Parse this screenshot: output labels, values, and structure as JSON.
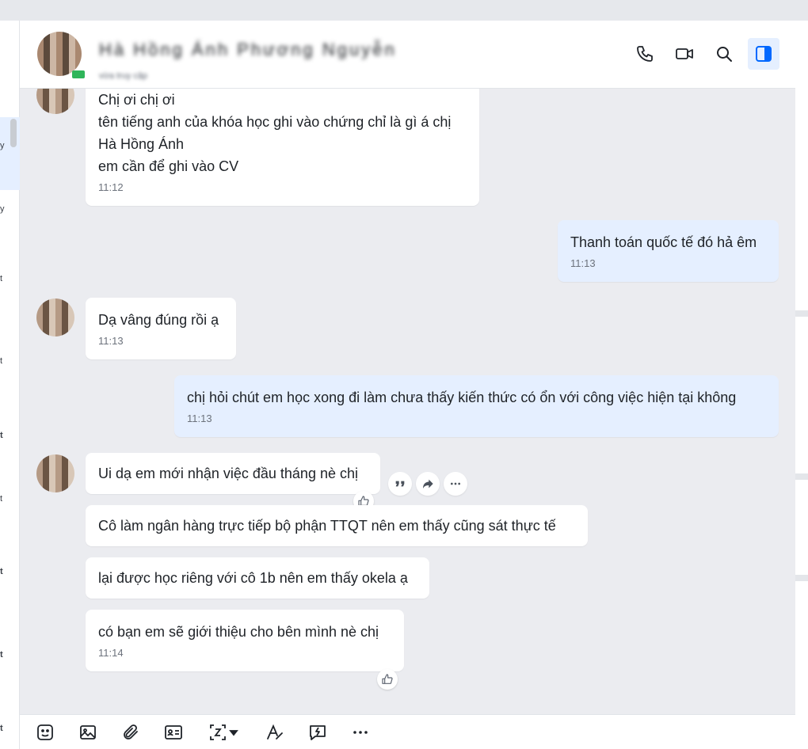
{
  "contact": {
    "name": "Hà Hồng Ánh Phương Nguyễn",
    "status": "vừa truy cập"
  },
  "header_actions": [
    {
      "icon": "phone-icon"
    },
    {
      "icon": "video-call-icon"
    },
    {
      "icon": "search-icon"
    },
    {
      "icon": "sidebar-toggle-icon",
      "active": true
    }
  ],
  "sidebar": {
    "fragments": [
      "y",
      "y",
      "t",
      "t",
      "t",
      "t",
      "t",
      "t",
      "t"
    ]
  },
  "messages": [
    {
      "from": "them",
      "lines": [
        "Chị ơi chị ơi",
        "tên tiếng anh của khóa học ghi vào chứng chỉ là gì á chị",
        "Hà Hồng Ánh",
        "em cần để ghi vào CV"
      ],
      "time": "11:12"
    },
    {
      "from": "me",
      "text": "Thanh toán quốc tế đó hả êm",
      "time": "11:13"
    },
    {
      "from": "them",
      "text": "Dạ vâng đúng rồi ạ",
      "time": "11:13"
    },
    {
      "from": "me",
      "text": "chị hỏi chút em học xong đi làm chưa thấy kiến thức có ổn với công việc hiện tại không",
      "time": "11:13"
    },
    {
      "from": "them",
      "text": "Ui dạ em mới nhận việc đầu tháng nè chị"
    },
    {
      "from": "them",
      "text": "Cô làm ngân hàng trực tiếp bộ phận TTQT nên em thấy cũng sát thực tế"
    },
    {
      "from": "them",
      "text": "lại được học riêng với cô 1b nên em thấy okela ạ"
    },
    {
      "from": "them",
      "text": "có bạn em sẽ giới thiệu cho bên mình nè chị",
      "time": "11:14"
    }
  ],
  "message_tools": [
    {
      "icon": "quote-icon"
    },
    {
      "icon": "forward-icon"
    },
    {
      "icon": "more-icon"
    }
  ],
  "composer_toolbar": [
    {
      "icon": "sticker-icon"
    },
    {
      "icon": "image-icon"
    },
    {
      "icon": "attachment-icon"
    },
    {
      "icon": "contact-card-icon"
    },
    {
      "icon": "screenshot-icon"
    },
    {
      "icon": "text-format-icon"
    },
    {
      "icon": "quick-message-icon"
    },
    {
      "icon": "more-options-icon"
    }
  ],
  "colors": {
    "my_bubble": "#e5efff",
    "their_bubble": "#ffffff",
    "chat_background": "#ebecf0",
    "online": "#2fb55a"
  }
}
